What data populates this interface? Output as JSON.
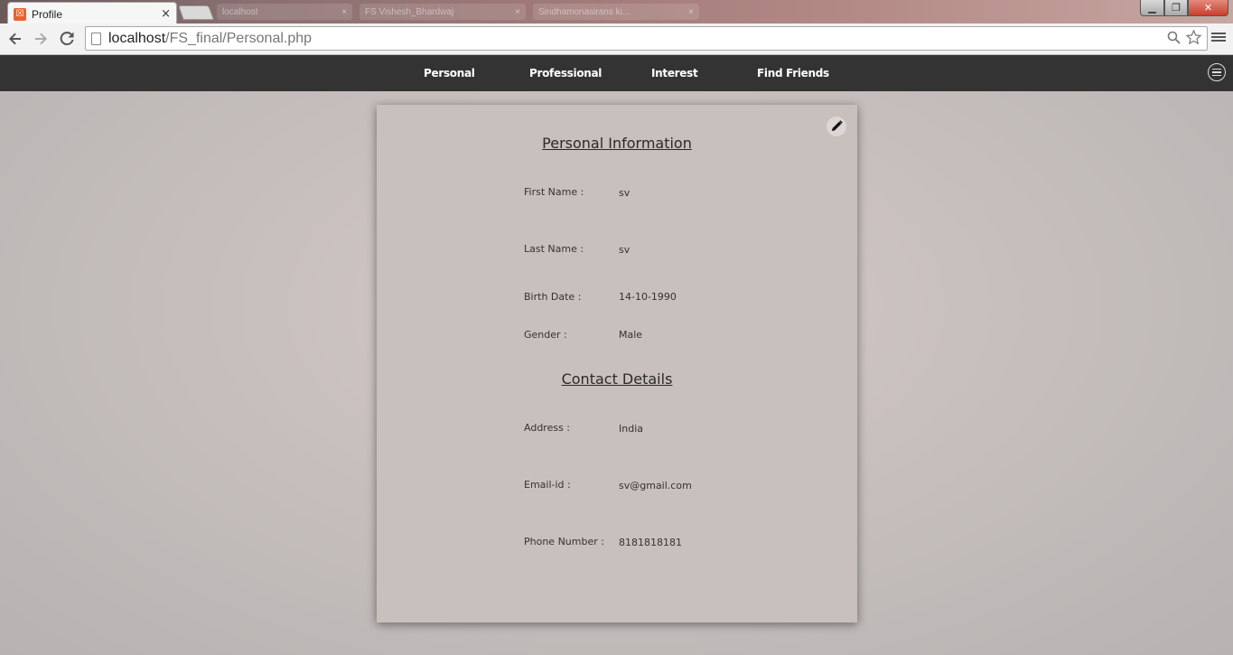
{
  "browser": {
    "tab_title": "Profile",
    "tab_close": "×",
    "background_tabs": [
      "localhost",
      "FS Vishesh_Bhardwaj",
      "Sindhamonasirans ki..."
    ],
    "url_host": "localhost",
    "url_path": "/FS_final/Personal.php",
    "window_controls": {
      "minimize": "▁",
      "maximize": "❐",
      "close": "✕"
    }
  },
  "nav": {
    "items": [
      "Personal",
      "Professional",
      "Interest",
      "Find Friends"
    ]
  },
  "profile": {
    "personal_title": "Personal Information",
    "contact_title": "Contact Details",
    "personal_fields": [
      {
        "label": "First Name :",
        "value": "sv"
      },
      {
        "label": "Last Name :",
        "value": "sv"
      },
      {
        "label": "Birth Date :",
        "value": "14-10-1990"
      },
      {
        "label": "Gender :",
        "value": "Male"
      }
    ],
    "contact_fields": [
      {
        "label": "Address :",
        "value": "India"
      },
      {
        "label": "Email-id :",
        "value": "sv@gmail.com"
      },
      {
        "label": "Phone Number :",
        "value": "8181818181"
      }
    ]
  },
  "icons": {
    "edit": "pencil-icon",
    "menu": "hamburger-icon"
  },
  "colors": {
    "navbar": "#333333",
    "card": "#c8c0bd",
    "page_bg": "#bdb8b6",
    "favicon": "#e8632c"
  }
}
